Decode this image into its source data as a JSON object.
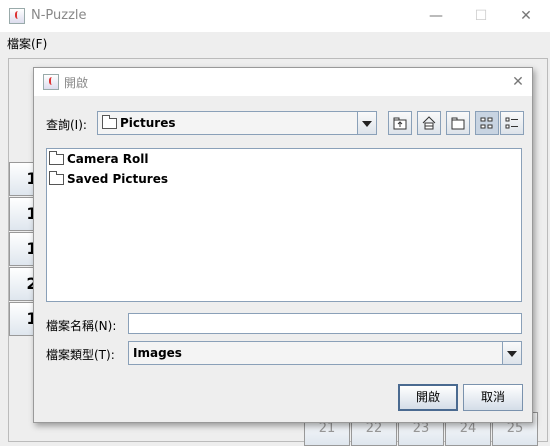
{
  "window": {
    "title": "N-Puzzle",
    "minimize": "—",
    "maximize": "☐",
    "close": "✕"
  },
  "menubar": {
    "file_label": "檔案(F)"
  },
  "board": {
    "tiles_left": [
      "1",
      "1",
      "1",
      "2",
      "1"
    ],
    "tiles_bottom": [
      "21",
      "22",
      "23",
      "24",
      "25"
    ]
  },
  "dialog": {
    "title": "開啟",
    "close": "✕",
    "lookin_label": "查詢(I):",
    "lookin_value": "Pictures",
    "toolbar": [
      "up-one-level-icon",
      "home-icon",
      "new-folder-icon",
      "list-view-icon",
      "details-view-icon"
    ],
    "files": [
      "Camera Roll",
      "Saved Pictures"
    ],
    "filename_label": "檔案名稱(N):",
    "filename_value": "",
    "filetype_label": "檔案類型(T):",
    "filetype_value": "Images",
    "open_button": "開啟",
    "cancel_button": "取消"
  }
}
